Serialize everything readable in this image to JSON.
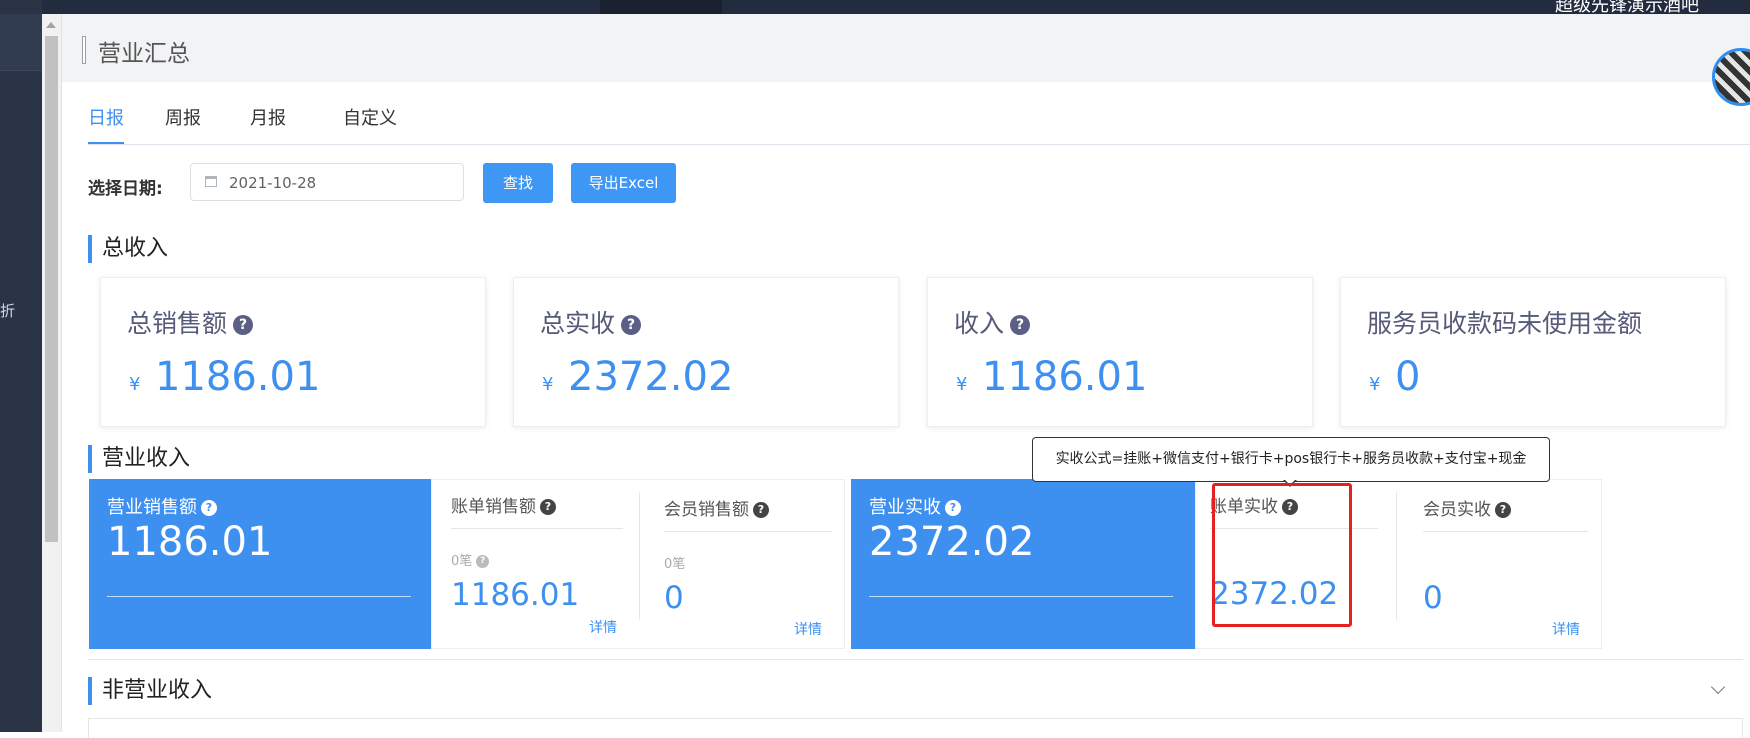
{
  "topbar": {
    "user_text": "超级先锋演示酒吧"
  },
  "sidebar": {
    "partial_text": "折"
  },
  "page": {
    "title": "营业汇总"
  },
  "tabs": [
    {
      "label": "日报",
      "active": true
    },
    {
      "label": "周报",
      "active": false
    },
    {
      "label": "月报",
      "active": false
    },
    {
      "label": "自定义",
      "active": false
    }
  ],
  "filter": {
    "date_label": "选择日期:",
    "date_value": "2021-10-28",
    "search_button": "查找",
    "export_button": "导出Excel"
  },
  "total_income": {
    "title": "总收入",
    "currency": "¥",
    "cards": [
      {
        "label": "总销售额",
        "value": "1186.01",
        "help": true
      },
      {
        "label": "总实收",
        "value": "2372.02",
        "help": true
      },
      {
        "label": "收入",
        "value": "1186.01",
        "help": true
      },
      {
        "label": "服务员收款码未使用金额",
        "value": "0",
        "help": false
      }
    ]
  },
  "business_income": {
    "title": "营业收入",
    "sales_panel": {
      "label": "营业销售额",
      "value": "1186.01"
    },
    "bill_sales": {
      "label": "账单销售额",
      "count": "0笔",
      "value": "1186.01"
    },
    "member_sales": {
      "label": "会员销售额",
      "count": "0笔",
      "value": "0",
      "link": "详情"
    },
    "bill_sales_link": "详情",
    "received_panel": {
      "label": "营业实收",
      "value": "2372.02"
    },
    "bill_received": {
      "label": "账单实收",
      "value": "2372.02"
    },
    "member_received": {
      "label": "会员实收",
      "value": "0",
      "link": "详情"
    }
  },
  "tooltip": {
    "text": "实收公式=挂账+微信支付+银行卡+pos银行卡+服务员收款+支付宝+现金"
  },
  "non_business_income": {
    "title": "非营业收入"
  },
  "icons": {
    "help": "question-circle-icon",
    "calendar": "calendar-icon",
    "collapse": "chevron-down-icon"
  },
  "colors": {
    "accent": "#3d8ff0",
    "highlight": "#e62020",
    "sidebar": "#2b3447"
  }
}
